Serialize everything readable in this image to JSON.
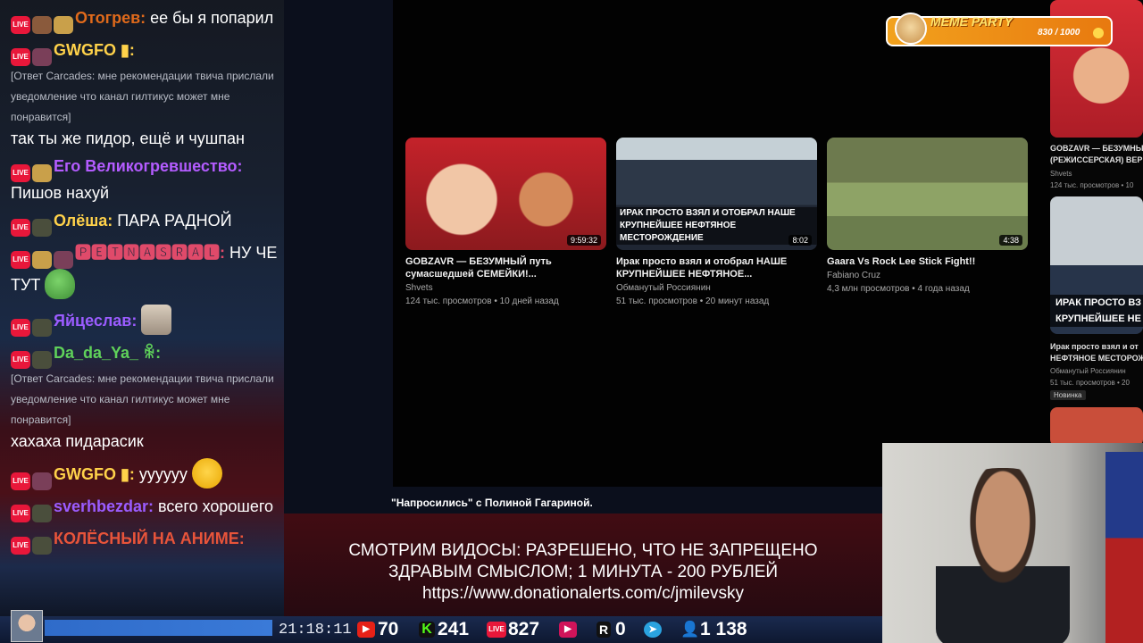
{
  "chat": {
    "messages": [
      {
        "user": "Отогрев:",
        "user_color": "#e06a1b",
        "text": " ее бы я попарил"
      },
      {
        "user": "GWGFO",
        "user_color": "#ffd24a",
        "suffix": " ▮:",
        "reply": "[Ответ Carcades: мне рекомендации твича прислали уведомление что канал гилтикус может мне понравится]",
        "text": "так ты же пидор, ещё и чушпан"
      },
      {
        "user": "Его Великогревшество:",
        "user_color": "#b45cff",
        "text": " Пишов нахуй"
      },
      {
        "user": "Олёша:",
        "user_color": "#ffd24a",
        "text": " ПАРА РАДНОЙ"
      },
      {
        "user": "🅿🅴🆃🅽🅰🆂🆁🅰🅻:",
        "user_color": "#e04a6a",
        "text": " НУ ЧЕ ТУТ"
      },
      {
        "user": "Яйцеслав:",
        "user_color": "#9b5cff",
        "text": ""
      },
      {
        "user": "Da_da_Ya_ ꆜ:",
        "user_color": "#5fd15a",
        "reply": "[Ответ Carcades: мне рекомендации твича прислали уведомление что канал гилтикус может мне понравится]",
        "text": "хахаха пидарасик"
      },
      {
        "user": "GWGFO",
        "user_color": "#ffd24a",
        "suffix": " ▮:",
        "text": " уууууу"
      },
      {
        "user": "sverhbezdar:",
        "user_color": "#9b5cff",
        "text": " всего хорошего"
      },
      {
        "user": "КОЛЁСНЫЙ НА АНИМЕ:",
        "user_color": "#e8543a",
        "text": ""
      }
    ]
  },
  "youtube": {
    "videos": [
      {
        "title": "GOBZAVR — БЕЗУМНЫЙ путь сумасшедшей СЕМЕЙКИ!...",
        "channel": "Shvets",
        "meta": "124 тыс. просмотров • 10 дней назад",
        "duration": "9:59:32"
      },
      {
        "title": "Ирак просто взял и отобрал НАШЕ КРУПНЕЙШЕЕ НЕФТЯНОЕ...",
        "channel": "Обманутый Россиянин",
        "meta": "51 тыс. просмотров • 20 минут назад",
        "duration": "8:02",
        "thumb_caption": "ИРАК ПРОСТО ВЗЯЛ И ОТОБРАЛ НАШЕ КРУПНЕЙШЕЕ НЕФТЯНОЕ МЕСТОРОЖДЕНИЕ"
      },
      {
        "title": "Gaara Vs Rock Lee Stick Fight!!",
        "channel": "Fabiano Cruz",
        "meta": "4,3 млн просмотров • 4 года назад",
        "duration": "4:38"
      }
    ],
    "caption": "\"Напросились\" с Полиной Гагариной."
  },
  "sidebar": {
    "v1_title1": "GOBZAVR — БЕЗУМНЫ",
    "v1_title2": "(РЕЖИССЕРСКАЯ) ВЕР",
    "v1_channel": "Shvets",
    "v1_meta": "124 тыс. просмотров • 10",
    "v2_caption1": "ИРАК ПРОСТО ВЗ",
    "v2_caption2": "КРУПНЕЙШЕЕ НЕ",
    "v2_title1": "Ирак просто взял и от",
    "v2_title2": "НЕФТЯНОЕ МЕСТОРОЖ",
    "v2_channel": "Обманутый Россиянин",
    "v2_meta": "51 тыс. просмотров • 20",
    "v2_badge": "Новинка"
  },
  "meme_party": {
    "title": "MEME PARTY",
    "count": "830 / 1000"
  },
  "banner": {
    "line1": "СМОТРИМ ВИДОСЫ: РАЗРЕШЕНО, ЧТО НЕ ЗАПРЕЩЕНО",
    "line2": "ЗДРАВЫМ СМЫСЛОМ; 1 МИНУТА - 200 РУБЛЕЙ",
    "line3": "https://www.donationalerts.com/c/jmilevsky"
  },
  "status_bar": {
    "time": "21:18:11",
    "youtube_viewers": "70",
    "kick_viewers": "241",
    "live_viewers": "827",
    "vk_viewers": "0",
    "telegram_label": "",
    "total_viewers": "1 138",
    "progress_fraction": 0.0
  },
  "colors": {
    "youtube": "#e62117",
    "kick": "#53fc18",
    "live": "#e8173a",
    "telegram": "#2aa3e0",
    "viewers": "#4aa8ff"
  }
}
